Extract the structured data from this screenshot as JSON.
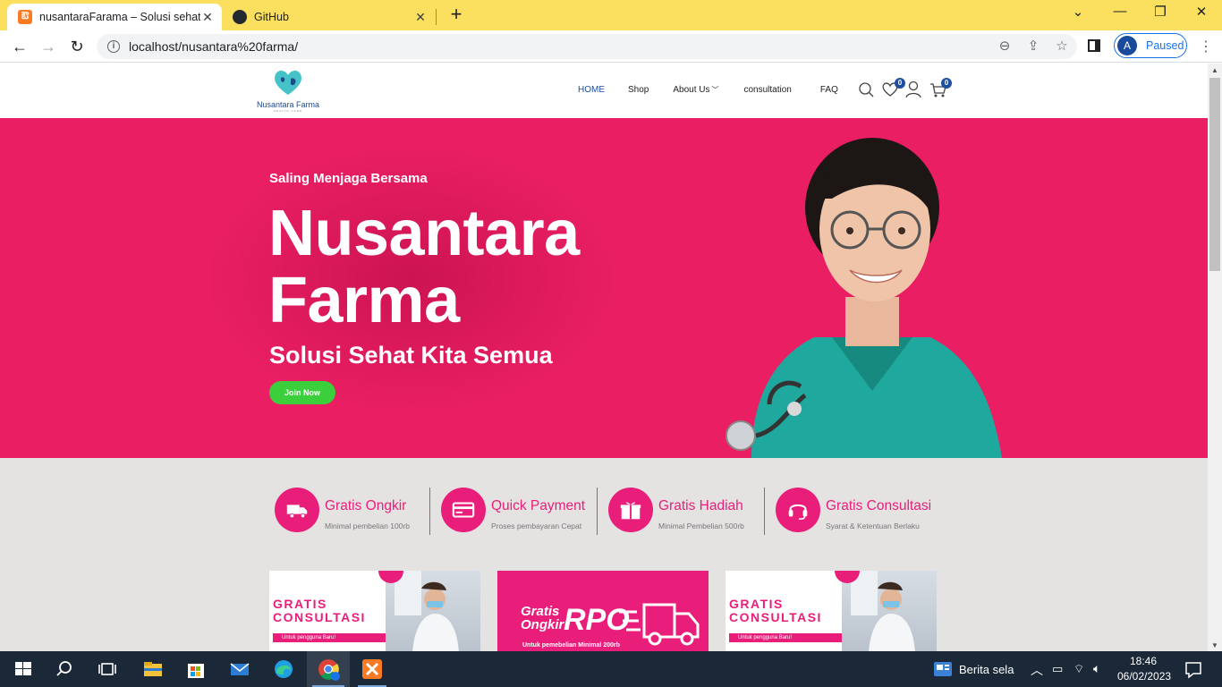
{
  "browser": {
    "tabs": [
      {
        "title": "nusantaraFarama – Solusi sehat k",
        "close": "✕",
        "favicon_letter": "ఔ"
      },
      {
        "title": "GitHub",
        "close": "✕"
      }
    ],
    "new_tab": "+",
    "window_controls": {
      "chevron": "⌄",
      "minimize": "—",
      "restore": "❐",
      "close": "✕"
    },
    "nav": {
      "back": "←",
      "forward": "→",
      "reload": "↻"
    },
    "url": "localhost/nusantara%20farma/",
    "profile": {
      "initial": "A",
      "status": "Paused"
    },
    "omni_icons": {
      "zoom": "⊖",
      "share": "⇪",
      "star": "☆"
    }
  },
  "site": {
    "logo": {
      "brand": "Nusantara Farma",
      "sub": "HEALTH CARE"
    },
    "nav": [
      {
        "label": "HOME",
        "active": true
      },
      {
        "label": "Shop"
      },
      {
        "label": "About Us"
      },
      {
        "label": "consultation"
      },
      {
        "label": "FAQ"
      }
    ],
    "wishlist_count": "0",
    "cart_count": "0",
    "hero": {
      "kicker": "Saling Menjaga Bersama",
      "headline_line1": "Nusantara",
      "headline_line2": "Farma",
      "tagline": "Solusi Sehat Kita Semua",
      "cta": "Join Now"
    },
    "features": [
      {
        "title": "Gratis Ongkir",
        "sub": "Minimal pembelian 100rb"
      },
      {
        "title": "Quick Payment",
        "sub": "Proses pembayaran Cepat"
      },
      {
        "title": "Gratis Hadiah",
        "sub": "Minimal Pembelian 500rb"
      },
      {
        "title": "Gratis Consultasi",
        "sub": "Syarat & Ketentuan Berlaku"
      }
    ],
    "promos": {
      "consult_line1": "GRATIS",
      "consult_line2": "CONSULTASI",
      "consult_band": "Untuk pengguna Baru!",
      "ongkir_line1": "Gratis",
      "ongkir_line2": "Ongkir",
      "ongkir_big": "RPO",
      "ongkir_sub": "Untuk pemebelian Minimal 200rb"
    }
  },
  "colors": {
    "accent": "#e91e63",
    "feature_pink": "#e91e7b",
    "cta_green": "#3ccf3c",
    "nav_blue": "#1e4fa1"
  },
  "taskbar": {
    "news": "Berita sela",
    "time": "18:46",
    "date": "06/02/2023"
  }
}
